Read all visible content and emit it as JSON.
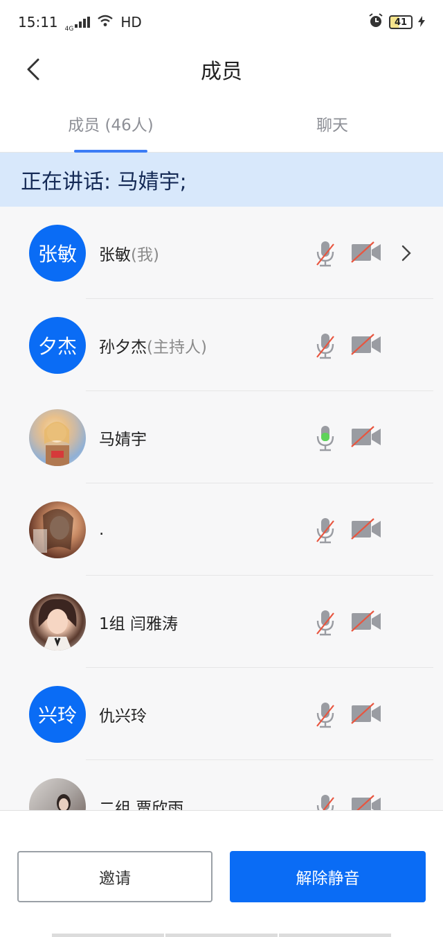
{
  "status": {
    "time": "15:11",
    "network": "4G",
    "hd": "HD",
    "battery": "41"
  },
  "header": {
    "title": "成员"
  },
  "tabs": [
    {
      "label": "成员 (46人)"
    },
    {
      "label": "聊天"
    }
  ],
  "speaking": "正在讲话: 马婧宇;",
  "members": [
    {
      "avatar_text": "张敏",
      "name": "张敏",
      "tag": "(我)",
      "mic_active": false
    },
    {
      "avatar_text": "夕杰",
      "name": "孙夕杰",
      "tag": "(主持人)",
      "mic_active": false
    },
    {
      "avatar_text": "",
      "name": "马婧宇",
      "tag": "",
      "mic_active": true
    },
    {
      "avatar_text": "",
      "name": ".",
      "tag": "",
      "mic_active": false
    },
    {
      "avatar_text": "",
      "name": "1组 闫雅涛",
      "tag": "",
      "mic_active": false
    },
    {
      "avatar_text": "兴玲",
      "name": "仇兴玲",
      "tag": "",
      "mic_active": false
    },
    {
      "avatar_text": "",
      "name": "二组 贾欣雨",
      "tag": "",
      "mic_active": false
    }
  ],
  "buttons": {
    "invite": "邀请",
    "unmute": "解除静音"
  },
  "colors": {
    "accent": "#0a6cf5",
    "mic_active": "#5fd35a",
    "mute_slash": "#e8553f"
  }
}
